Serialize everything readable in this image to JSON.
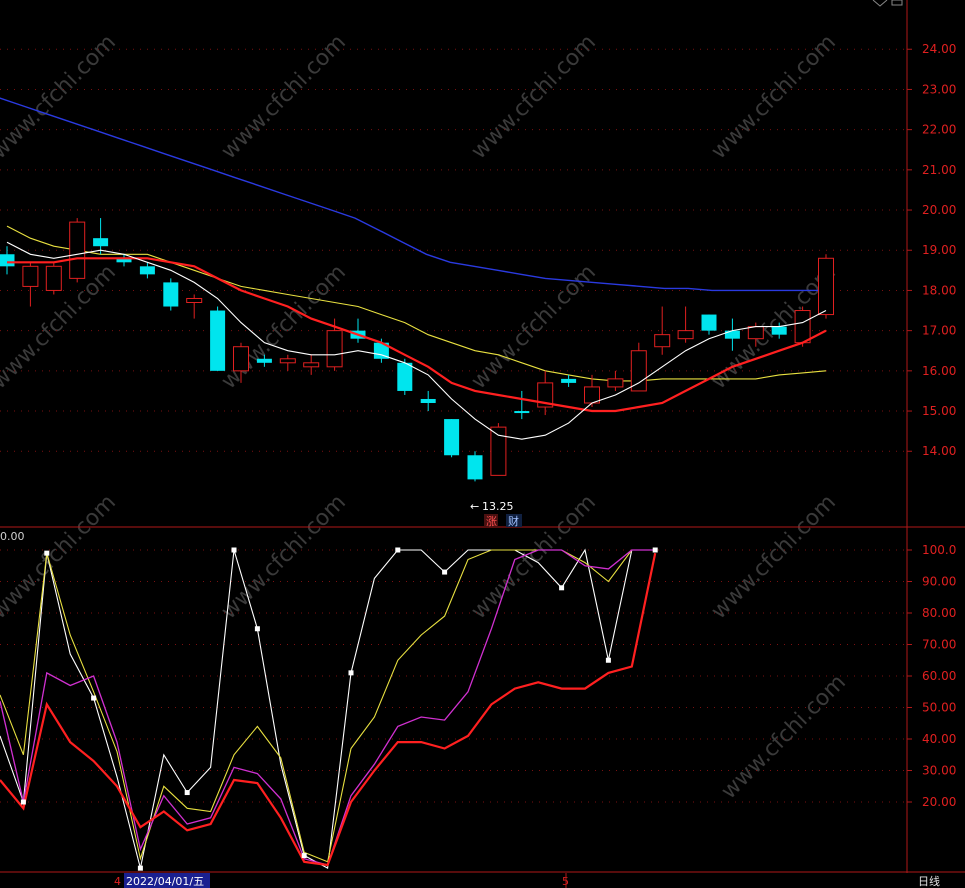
{
  "watermark": "www.cfchi.com",
  "timeframe": "日线",
  "bottom_axis": {
    "month_a": "4",
    "date_label": "2022/04/01/五",
    "month_b": "5"
  },
  "price_panel": {
    "ticks": [
      "24.00",
      "23.00",
      "22.00",
      "21.00",
      "20.00",
      "19.00",
      "18.00",
      "17.00",
      "16.00",
      "15.00",
      "14.00"
    ],
    "min_label": "13.25",
    "badge_zhang": "涨",
    "badge_cai": "财"
  },
  "osc_panel": {
    "left_label": "0.00",
    "ticks": [
      "100.0",
      "90.00",
      "80.00",
      "70.00",
      "60.00",
      "50.00",
      "40.00",
      "30.00",
      "20.00"
    ]
  },
  "colors": {
    "up": "#e02020",
    "down": "#00e5ee",
    "ma_white": "#ffffff",
    "ma_red": "#ff2020",
    "ma_yellow": "#e8e040",
    "ma_blue": "#2a3ae0",
    "magenta": "#d030d0"
  },
  "chart_data": [
    {
      "type": "candlestick",
      "y_range": [
        13.0,
        25.2
      ],
      "candles": [
        {
          "o": 18.9,
          "h": 19.1,
          "c": 18.6,
          "l": 18.4
        },
        {
          "o": 18.1,
          "h": 18.7,
          "c": 18.6,
          "l": 17.6
        },
        {
          "o": 18.0,
          "h": 18.7,
          "c": 18.6,
          "l": 17.9
        },
        {
          "o": 18.3,
          "h": 19.8,
          "c": 19.7,
          "l": 18.2
        },
        {
          "o": 19.3,
          "h": 19.8,
          "c": 19.1,
          "l": 18.9
        },
        {
          "o": 18.8,
          "h": 18.9,
          "c": 18.7,
          "l": 18.6
        },
        {
          "o": 18.6,
          "h": 18.7,
          "c": 18.4,
          "l": 18.3
        },
        {
          "o": 18.2,
          "h": 18.3,
          "c": 17.6,
          "l": 17.5
        },
        {
          "o": 17.7,
          "h": 17.9,
          "c": 17.8,
          "l": 17.3
        },
        {
          "o": 17.5,
          "h": 17.6,
          "c": 16.0,
          "l": 16.0
        },
        {
          "o": 16.0,
          "h": 16.7,
          "c": 16.6,
          "l": 15.7
        },
        {
          "o": 16.3,
          "h": 16.4,
          "c": 16.2,
          "l": 16.1
        },
        {
          "o": 16.2,
          "h": 16.4,
          "c": 16.3,
          "l": 16.0
        },
        {
          "o": 16.1,
          "h": 16.4,
          "c": 16.2,
          "l": 15.9
        },
        {
          "o": 16.1,
          "h": 17.3,
          "c": 17.0,
          "l": 16.0
        },
        {
          "o": 17.0,
          "h": 17.3,
          "c": 16.8,
          "l": 16.7
        },
        {
          "o": 16.7,
          "h": 16.8,
          "c": 16.3,
          "l": 16.2
        },
        {
          "o": 16.2,
          "h": 16.3,
          "c": 15.5,
          "l": 15.4
        },
        {
          "o": 15.3,
          "h": 15.5,
          "c": 15.2,
          "l": 15.0
        },
        {
          "o": 14.8,
          "h": 14.8,
          "c": 13.9,
          "l": 13.85
        },
        {
          "o": 13.9,
          "h": 14.0,
          "c": 13.3,
          "l": 13.25
        },
        {
          "o": 13.4,
          "h": 14.7,
          "c": 14.6,
          "l": 13.4
        },
        {
          "o": 15.0,
          "h": 15.5,
          "c": 14.95,
          "l": 14.8
        },
        {
          "o": 15.1,
          "h": 16.0,
          "c": 15.7,
          "l": 14.9
        },
        {
          "o": 15.8,
          "h": 15.9,
          "c": 15.7,
          "l": 15.6
        },
        {
          "o": 15.2,
          "h": 15.9,
          "c": 15.6,
          "l": 15.1
        },
        {
          "o": 15.6,
          "h": 16.0,
          "c": 15.8,
          "l": 15.5
        },
        {
          "o": 15.5,
          "h": 16.7,
          "c": 16.5,
          "l": 15.5
        },
        {
          "o": 16.6,
          "h": 17.6,
          "c": 16.9,
          "l": 16.4
        },
        {
          "o": 16.8,
          "h": 17.6,
          "c": 17.0,
          "l": 16.7
        },
        {
          "o": 17.4,
          "h": 17.4,
          "c": 17.0,
          "l": 16.9
        },
        {
          "o": 17.0,
          "h": 17.3,
          "c": 16.8,
          "l": 16.5
        },
        {
          "o": 16.8,
          "h": 17.2,
          "c": 17.1,
          "l": 16.6
        },
        {
          "o": 17.1,
          "h": 17.2,
          "c": 16.9,
          "l": 16.8
        },
        {
          "o": 16.7,
          "h": 17.6,
          "c": 17.5,
          "l": 16.6
        },
        {
          "o": 17.4,
          "h": 18.9,
          "c": 18.8,
          "l": 17.3
        }
      ],
      "ma_white": [
        19.2,
        18.9,
        18.8,
        18.9,
        19.0,
        18.9,
        18.7,
        18.5,
        18.2,
        17.8,
        17.2,
        16.7,
        16.5,
        16.4,
        16.4,
        16.5,
        16.4,
        16.2,
        15.9,
        15.3,
        14.8,
        14.4,
        14.3,
        14.4,
        14.7,
        15.2,
        15.4,
        15.7,
        16.1,
        16.5,
        16.8,
        17.0,
        17.1,
        17.1,
        17.2,
        17.5
      ],
      "ma_red": [
        18.7,
        18.7,
        18.7,
        18.8,
        18.8,
        18.8,
        18.8,
        18.7,
        18.6,
        18.3,
        18.0,
        17.8,
        17.6,
        17.3,
        17.1,
        16.9,
        16.7,
        16.4,
        16.1,
        15.7,
        15.5,
        15.4,
        15.3,
        15.2,
        15.1,
        15.0,
        15.0,
        15.1,
        15.2,
        15.5,
        15.8,
        16.1,
        16.3,
        16.5,
        16.7,
        17.0
      ],
      "ma_yellow": [
        19.6,
        19.3,
        19.1,
        19.0,
        18.9,
        18.9,
        18.9,
        18.7,
        18.5,
        18.3,
        18.1,
        18.0,
        17.9,
        17.8,
        17.7,
        17.6,
        17.4,
        17.2,
        16.9,
        16.7,
        16.5,
        16.4,
        16.2,
        16.0,
        15.9,
        15.8,
        15.75,
        15.75,
        15.8,
        15.8,
        15.8,
        15.8,
        15.8,
        15.9,
        15.95,
        16.0
      ],
      "ma_blue": [
        22.8,
        22.6,
        22.4,
        22.2,
        22.0,
        21.8,
        21.6,
        21.4,
        21.2,
        21.0,
        20.8,
        20.6,
        20.4,
        20.2,
        20.0,
        19.8,
        19.5,
        19.2,
        18.9,
        18.7,
        18.6,
        18.5,
        18.4,
        18.3,
        18.25,
        18.2,
        18.15,
        18.1,
        18.05,
        18.05,
        18.0,
        18.0,
        18.0,
        18.0,
        18.0,
        18.0
      ]
    },
    {
      "type": "line",
      "y_range": [
        -5,
        102
      ],
      "series": [
        {
          "key": "white",
          "values": [
            41,
            20,
            99,
            67,
            53,
            28,
            -1,
            35,
            23,
            31,
            100,
            75,
            32,
            3,
            -1,
            61,
            91,
            100,
            100,
            93,
            100,
            100,
            100,
            96,
            88,
            100,
            65,
            100,
            100
          ]
        },
        {
          "key": "yellow",
          "values": [
            54,
            35,
            99,
            73,
            55,
            36,
            2,
            25,
            18,
            17,
            35,
            44,
            34,
            4,
            1,
            37,
            47,
            65,
            73,
            79,
            97,
            100,
            100,
            100,
            100,
            96,
            90,
            100,
            100
          ]
        },
        {
          "key": "magenta",
          "values": [
            52,
            20,
            61,
            57,
            60,
            39,
            5,
            22,
            13,
            15,
            31,
            29,
            21,
            2,
            0,
            22,
            32,
            44,
            47,
            46,
            55,
            75,
            97,
            100,
            100,
            95,
            94,
            100,
            100
          ]
        },
        {
          "key": "red",
          "values": [
            27,
            18,
            51,
            39,
            33,
            25,
            12,
            17,
            11,
            13,
            27,
            26,
            15,
            1,
            0,
            20,
            30,
            39,
            39,
            37,
            41,
            51,
            56,
            58,
            56,
            56,
            61,
            63,
            99
          ]
        }
      ],
      "white_markers": [
        1,
        2,
        4,
        6,
        8,
        10,
        11,
        13,
        15,
        17,
        19,
        24,
        26,
        28
      ]
    }
  ]
}
